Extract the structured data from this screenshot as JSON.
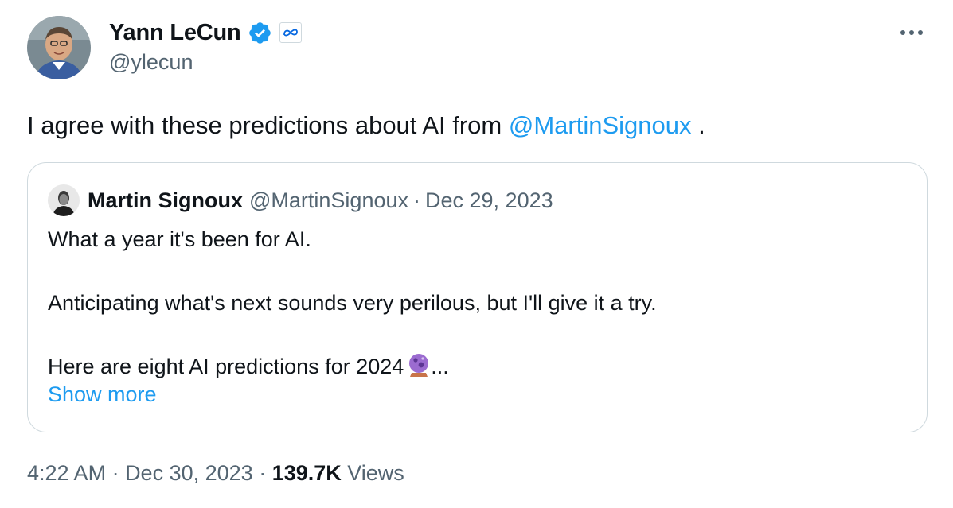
{
  "author": {
    "display_name": "Yann LeCun",
    "handle": "@ylecun",
    "verified_icon": "verified-badge-icon",
    "affiliation_icon": "meta-logo-icon"
  },
  "tweet": {
    "text_prefix": "I agree with these predictions about AI from ",
    "mention": "@MartinSignoux",
    "text_suffix": " ."
  },
  "quote": {
    "display_name": "Martin Signoux",
    "handle": "@MartinSignoux",
    "separator": "·",
    "date": "Dec 29, 2023",
    "line1": "What a year it's been for AI.",
    "line2": "Anticipating what's next sounds very perilous, but I'll give it a try.",
    "line3": "Here are eight AI predictions for 2024",
    "ellipsis": "...",
    "show_more": "Show more"
  },
  "meta": {
    "time": "4:22 AM",
    "separator1": " · ",
    "date": "Dec 30, 2023",
    "separator2": " · ",
    "views_count": "139.7K",
    "views_label": " Views"
  },
  "colors": {
    "accent": "#1d9bf0",
    "secondary_text": "#536471",
    "border": "#cfd9de"
  }
}
